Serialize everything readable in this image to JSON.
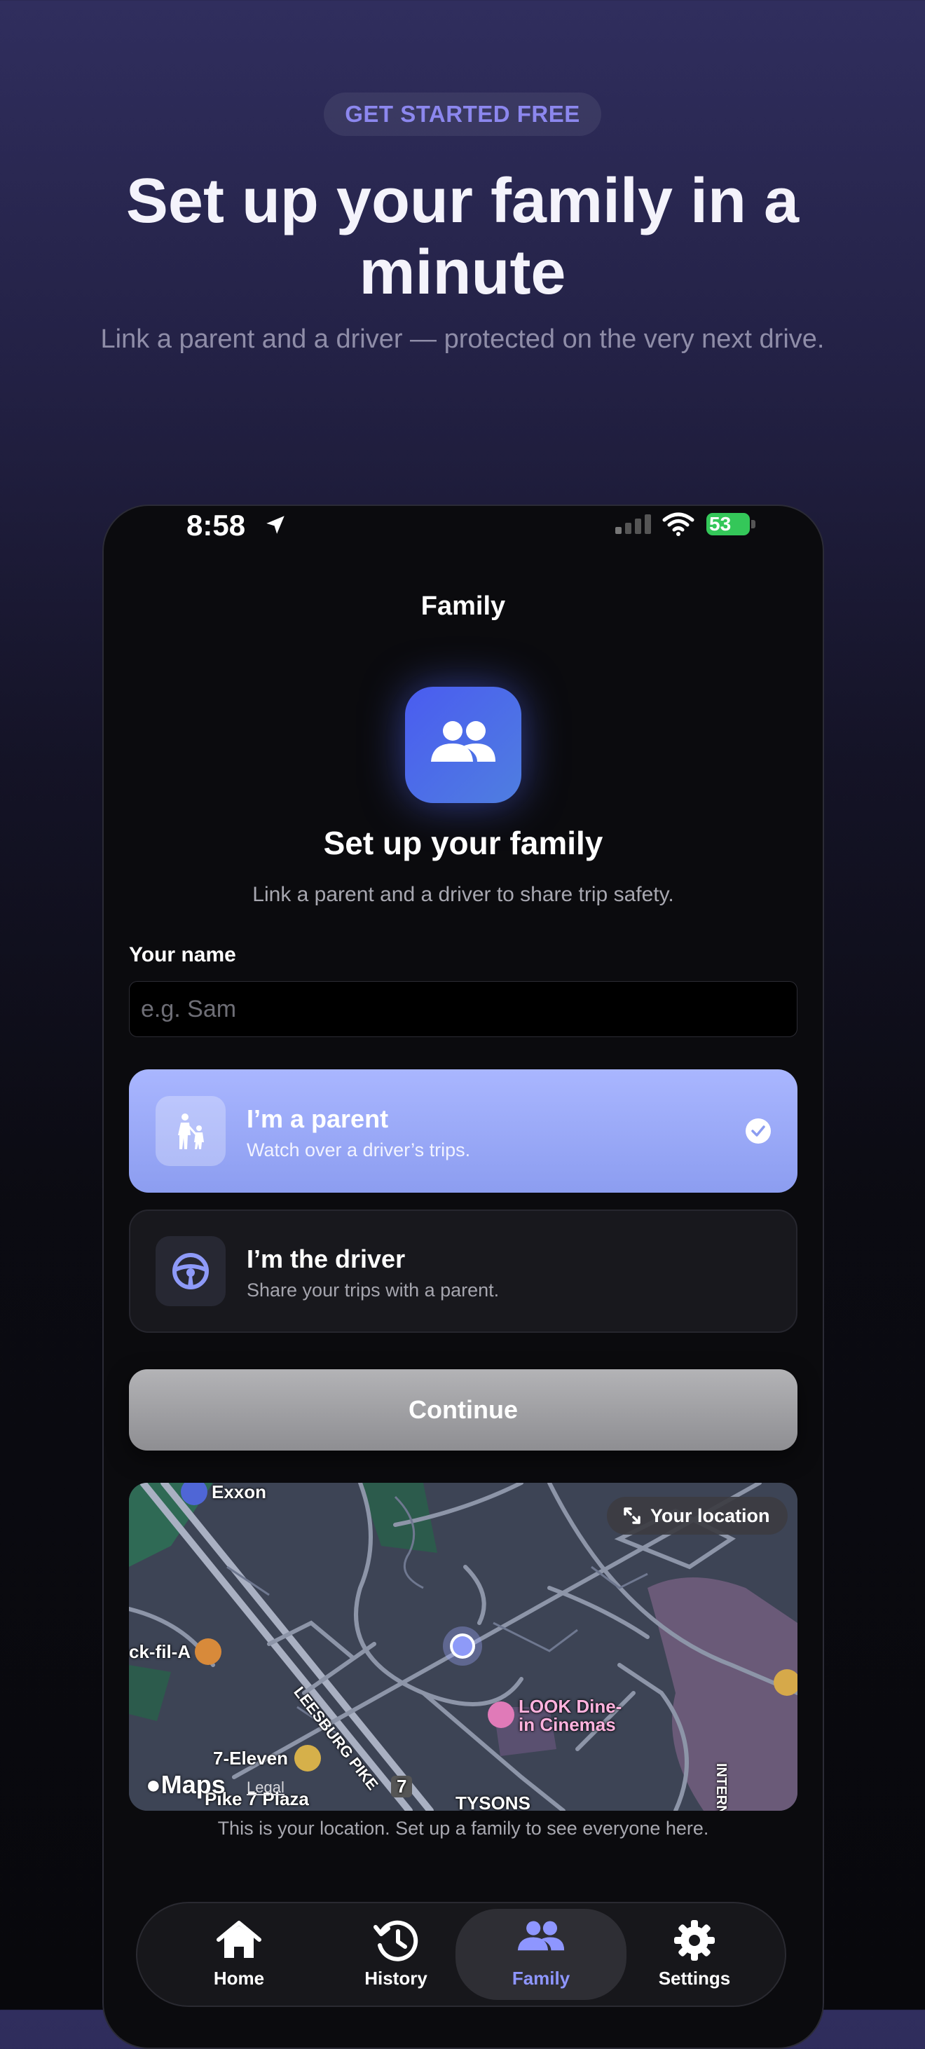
{
  "hero": {
    "badge": "GET STARTED FREE",
    "title": "Set up your family in a minute",
    "subtitle": "Link a parent and a driver — protected on the very next drive."
  },
  "status_bar": {
    "time": "8:58",
    "battery": "53"
  },
  "nav": {
    "title": "Family"
  },
  "setup": {
    "icon": "family-people-icon",
    "title": "Set up your family",
    "subtitle": "Link a parent and a driver to share trip safety."
  },
  "name_field": {
    "label": "Your name",
    "placeholder": "e.g. Sam",
    "value": ""
  },
  "roles": [
    {
      "title": "I’m a parent",
      "description": "Watch over a driver’s trips.",
      "icon": "parent-child-icon",
      "selected": true
    },
    {
      "title": "I’m the driver",
      "description": "Share your trips with a parent.",
      "icon": "steering-wheel-icon",
      "selected": false
    }
  ],
  "continue_label": "Continue",
  "map": {
    "your_location_label": "Your location",
    "labels": {
      "exxon": "Exxon",
      "chick": "ck-fil-A",
      "leesburg": "LEESBURG PIKE",
      "seven_eleven": "7-Eleven",
      "look_line1": "LOOK Dine-",
      "look_line2": "in Cinemas",
      "pike7": "Pike 7 Plaza",
      "route": "7",
      "tysons": "TYSONS",
      "internat": "INTERNAT"
    },
    "logo": "Maps",
    "legal": "Legal",
    "caption": "This is your location. Set up a family to see everyone here."
  },
  "tabs": [
    {
      "label": "Home",
      "icon": "home-icon",
      "active": false
    },
    {
      "label": "History",
      "icon": "history-clock-icon",
      "active": false
    },
    {
      "label": "Family",
      "icon": "family-people-icon",
      "active": true
    },
    {
      "label": "Settings",
      "icon": "gear-icon",
      "active": false
    }
  ],
  "colors": {
    "accent": "#8c87ee",
    "parent_card": "#a9b6ff",
    "active_tab": "#8e96ff",
    "family_tile": "#4a5cf0",
    "battery_green": "#34c759"
  }
}
